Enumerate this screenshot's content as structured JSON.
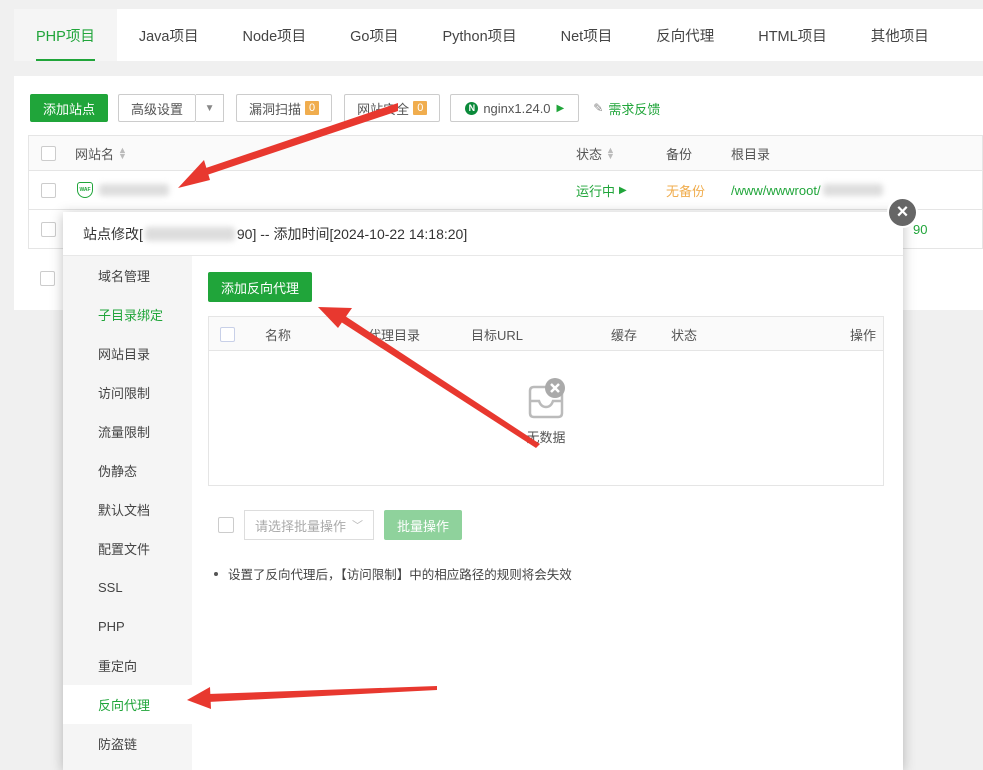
{
  "tabs": [
    "PHP项目",
    "Java项目",
    "Node项目",
    "Go项目",
    "Python项目",
    "Net项目",
    "反向代理",
    "HTML项目",
    "其他项目"
  ],
  "toolbar": {
    "add_site": "添加站点",
    "advanced": "高级设置",
    "vuln_scan": "漏洞扫描",
    "vuln_count": "0",
    "site_security": "网站安全",
    "security_count": "0",
    "nginx": "nginx1.24.0",
    "feedback": "需求反馈"
  },
  "table": {
    "col_name": "网站名",
    "col_status": "状态",
    "col_backup": "备份",
    "col_root": "根目录",
    "row1": {
      "status": "运行中",
      "backup": "无备份",
      "root": "/www/wwwroot/"
    },
    "row2": {
      "root_tail": "90"
    }
  },
  "modal": {
    "title_prefix": "站点修改[",
    "title_suffix": "90] -- 添加时间[2024-10-22 14:18:20]",
    "close": "×",
    "menu": [
      "域名管理",
      "子目录绑定",
      "网站目录",
      "访问限制",
      "流量限制",
      "伪静态",
      "默认文档",
      "配置文件",
      "SSL",
      "PHP",
      "重定向",
      "反向代理",
      "防盗链"
    ],
    "add_proxy": "添加反向代理",
    "columns": {
      "name": "名称",
      "proxy_dir": "代理目录",
      "target_url": "目标URL",
      "cache": "缓存",
      "status": "状态",
      "action": "操作"
    },
    "empty": "无数据",
    "batch_placeholder": "请选择批量操作",
    "batch_button": "批量操作",
    "tip": "设置了反向代理后，【访问限制】中的相应路径的规则将会失效"
  },
  "colors": {
    "accent": "#20a53a",
    "arrow": "#e8382f",
    "warning": "#f0ad4e"
  }
}
